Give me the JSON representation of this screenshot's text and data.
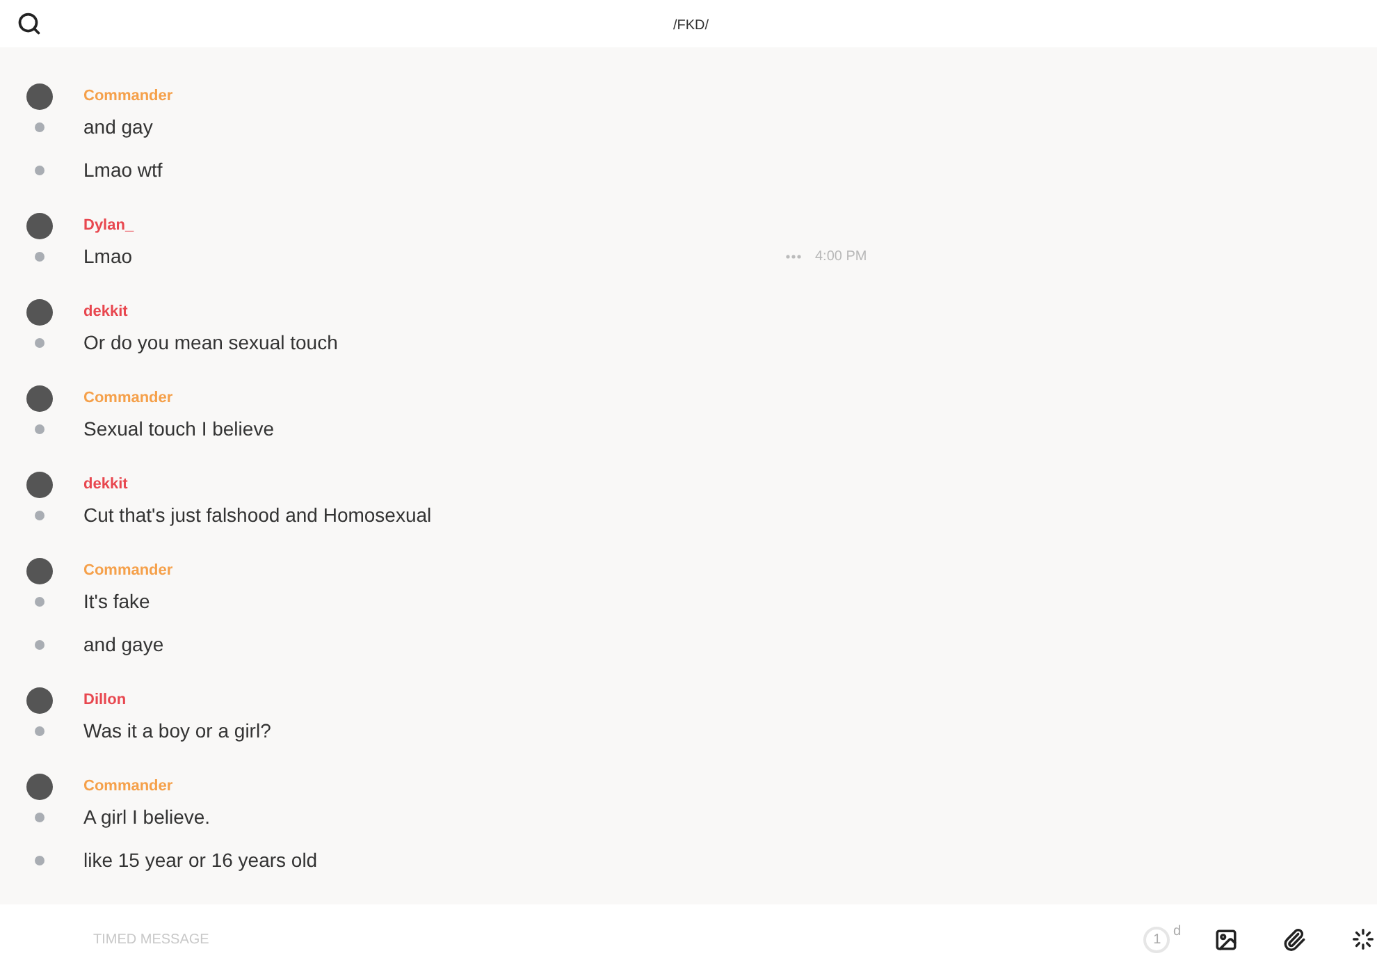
{
  "header": {
    "title": "/FKD/"
  },
  "groups": [
    {
      "sender": "Commander",
      "color": "#f5a04a",
      "messages": [
        {
          "text": "and gay"
        },
        {
          "text": "Lmao wtf"
        }
      ]
    },
    {
      "sender": "Dylan_",
      "color": "#e8474f",
      "messages": [
        {
          "text": "Lmao",
          "time": "4:00 PM"
        }
      ]
    },
    {
      "sender": "dekkit",
      "color": "#e8474f",
      "messages": [
        {
          "text": "Or do you mean sexual touch"
        }
      ]
    },
    {
      "sender": "Commander",
      "color": "#f5a04a",
      "messages": [
        {
          "text": "Sexual touch I believe"
        }
      ]
    },
    {
      "sender": "dekkit",
      "color": "#e8474f",
      "messages": [
        {
          "text": "Cut that's just falshood and Homosexual"
        }
      ]
    },
    {
      "sender": "Commander",
      "color": "#f5a04a",
      "messages": [
        {
          "text": "It's fake"
        },
        {
          "text": "and gaye"
        }
      ]
    },
    {
      "sender": "Dillon",
      "color": "#e8474f",
      "messages": [
        {
          "text": "Was it a boy or a girl?"
        }
      ]
    },
    {
      "sender": "Commander",
      "color": "#f5a04a",
      "messages": [
        {
          "text": "A girl I believe."
        },
        {
          "text": "like 15 year or 16 years old"
        }
      ]
    }
  ],
  "composer": {
    "placeholder": "TIMED MESSAGE",
    "timer": {
      "value": "1",
      "unit": "d"
    }
  }
}
